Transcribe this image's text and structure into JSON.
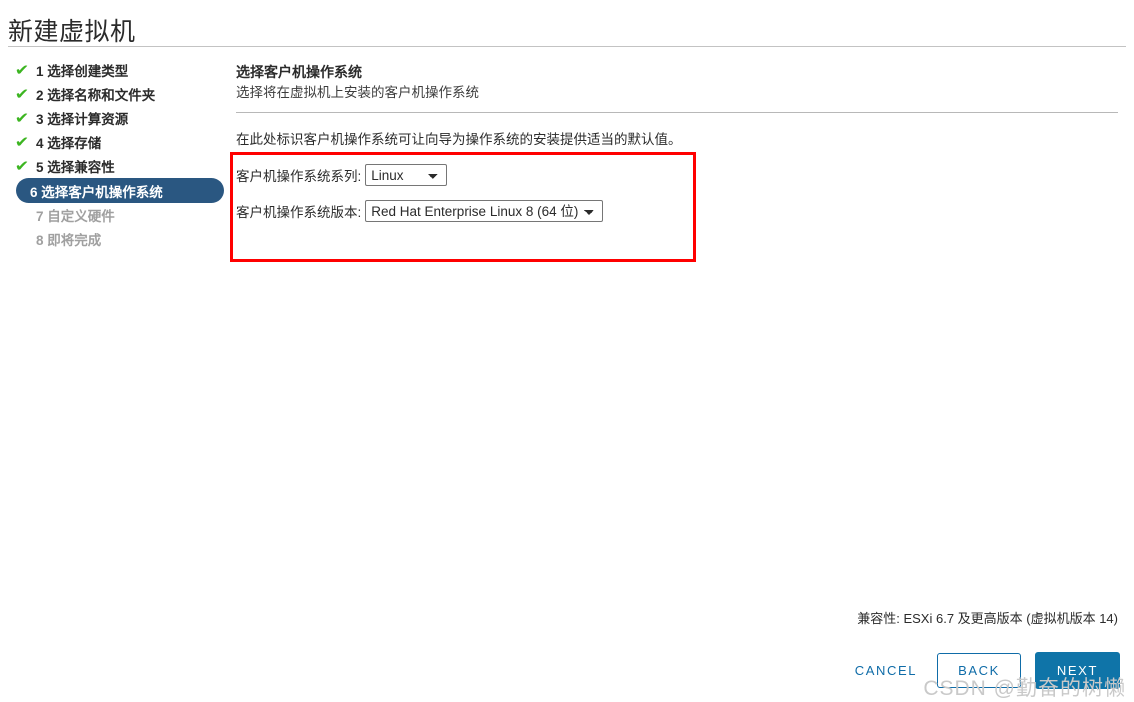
{
  "wizard": {
    "title": "新建虚拟机"
  },
  "steps": [
    {
      "num": "1",
      "label": "1 选择创建类型",
      "state": "done",
      "check": "✔"
    },
    {
      "num": "2",
      "label": "2 选择名称和文件夹",
      "state": "done",
      "check": "✔"
    },
    {
      "num": "3",
      "label": "3 选择计算资源",
      "state": "done",
      "check": "✔"
    },
    {
      "num": "4",
      "label": "4 选择存储",
      "state": "done",
      "check": "✔"
    },
    {
      "num": "5",
      "label": "5 选择兼容性",
      "state": "done",
      "check": "✔"
    },
    {
      "num": "6",
      "label": "6 选择客户机操作系统",
      "state": "active",
      "check": ""
    },
    {
      "num": "7",
      "label": "7 自定义硬件",
      "state": "pending",
      "check": ""
    },
    {
      "num": "8",
      "label": "8 即将完成",
      "state": "pending",
      "check": ""
    }
  ],
  "content": {
    "title": "选择客户机操作系统",
    "subtitle": "选择将在虚拟机上安装的客户机操作系统",
    "description": "在此处标识客户机操作系统可让向导为操作系统的安装提供适当的默认值。"
  },
  "form": {
    "family": {
      "label": "客户机操作系统系列:",
      "value": "Linux",
      "options": [
        "Linux"
      ]
    },
    "version": {
      "label": "客户机操作系统版本:",
      "value": "Red Hat Enterprise Linux 8 (64 位)",
      "options": [
        "Red Hat Enterprise Linux 8 (64 位)"
      ]
    }
  },
  "footer": {
    "compatibility": "兼容性: ESXi 6.7 及更高版本 (虚拟机版本 14)",
    "cancel_label": "CANCEL",
    "back_label": "BACK",
    "next_label": "NEXT"
  },
  "watermark": {
    "text": "CSDN @勤奋的树懒"
  },
  "colors": {
    "accent_blue": "#0f74a8",
    "link_blue": "#0f6ca8",
    "active_step_bg": "#2a5781",
    "check_green": "#3cb521",
    "highlight_red": "#ff0000"
  }
}
